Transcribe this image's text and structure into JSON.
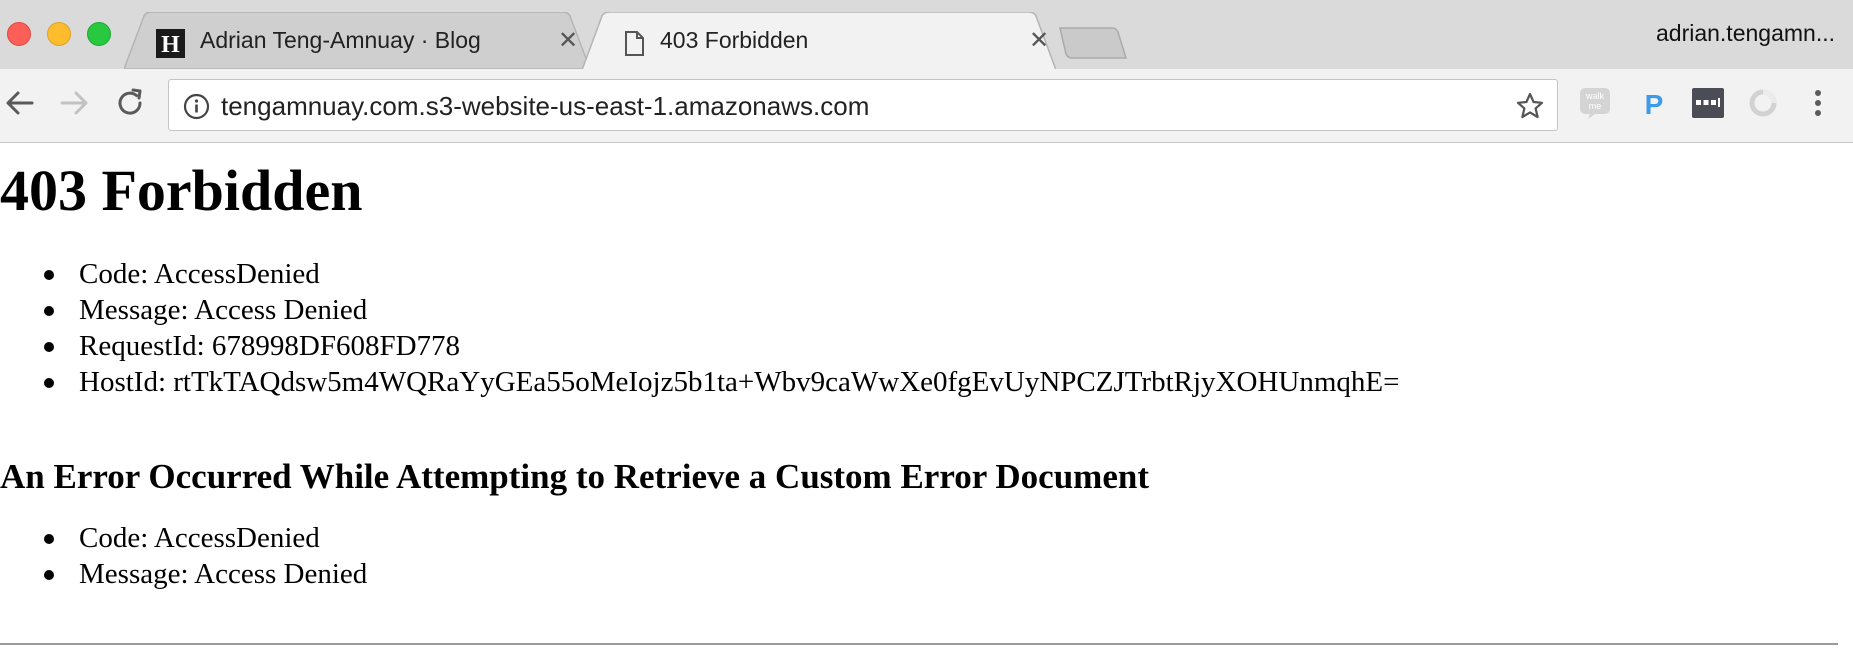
{
  "browser": {
    "tabs": [
      {
        "title": "Adrian Teng-Amnuay · Blog",
        "favicon": "h-logo-icon",
        "favicon_letter": "H",
        "active": false
      },
      {
        "title": "403 Forbidden",
        "favicon": "page-icon",
        "active": true
      }
    ],
    "close_glyph": "✕",
    "profile_name": "adrian.tengamn...",
    "address": "tengamnuay.com.s3-website-us-east-1.amazonaws.com",
    "extensions": [
      "walkme-icon",
      "p-extension-icon",
      "password-manager-icon",
      "ring-extension-icon"
    ],
    "extension_labels": {
      "walkme": "walk me",
      "p": "P"
    }
  },
  "page": {
    "title": "403 Forbidden",
    "details": [
      "Code: AccessDenied",
      "Message: Access Denied",
      "RequestId: 678998DF608FD778",
      "HostId: rtTkTAQdsw5m4WQRaYyGEa55oMeIojz5b1ta+Wbv9caWwXe0fgEvUyNPCZJTrbtRjyXOHUnmqhE="
    ],
    "error_heading": "An Error Occurred While Attempting to Retrieve a Custom Error Document",
    "error_details": [
      "Code: AccessDenied",
      "Message: Access Denied"
    ]
  },
  "colors": {
    "tabstrip_bg": "#dadada",
    "toolbar_bg": "#f2f2f2",
    "close_red": "#fc5f57",
    "minimize_yellow": "#fdbc2e",
    "zoom_green": "#29c841",
    "p_extension_blue": "#3d9be9"
  }
}
